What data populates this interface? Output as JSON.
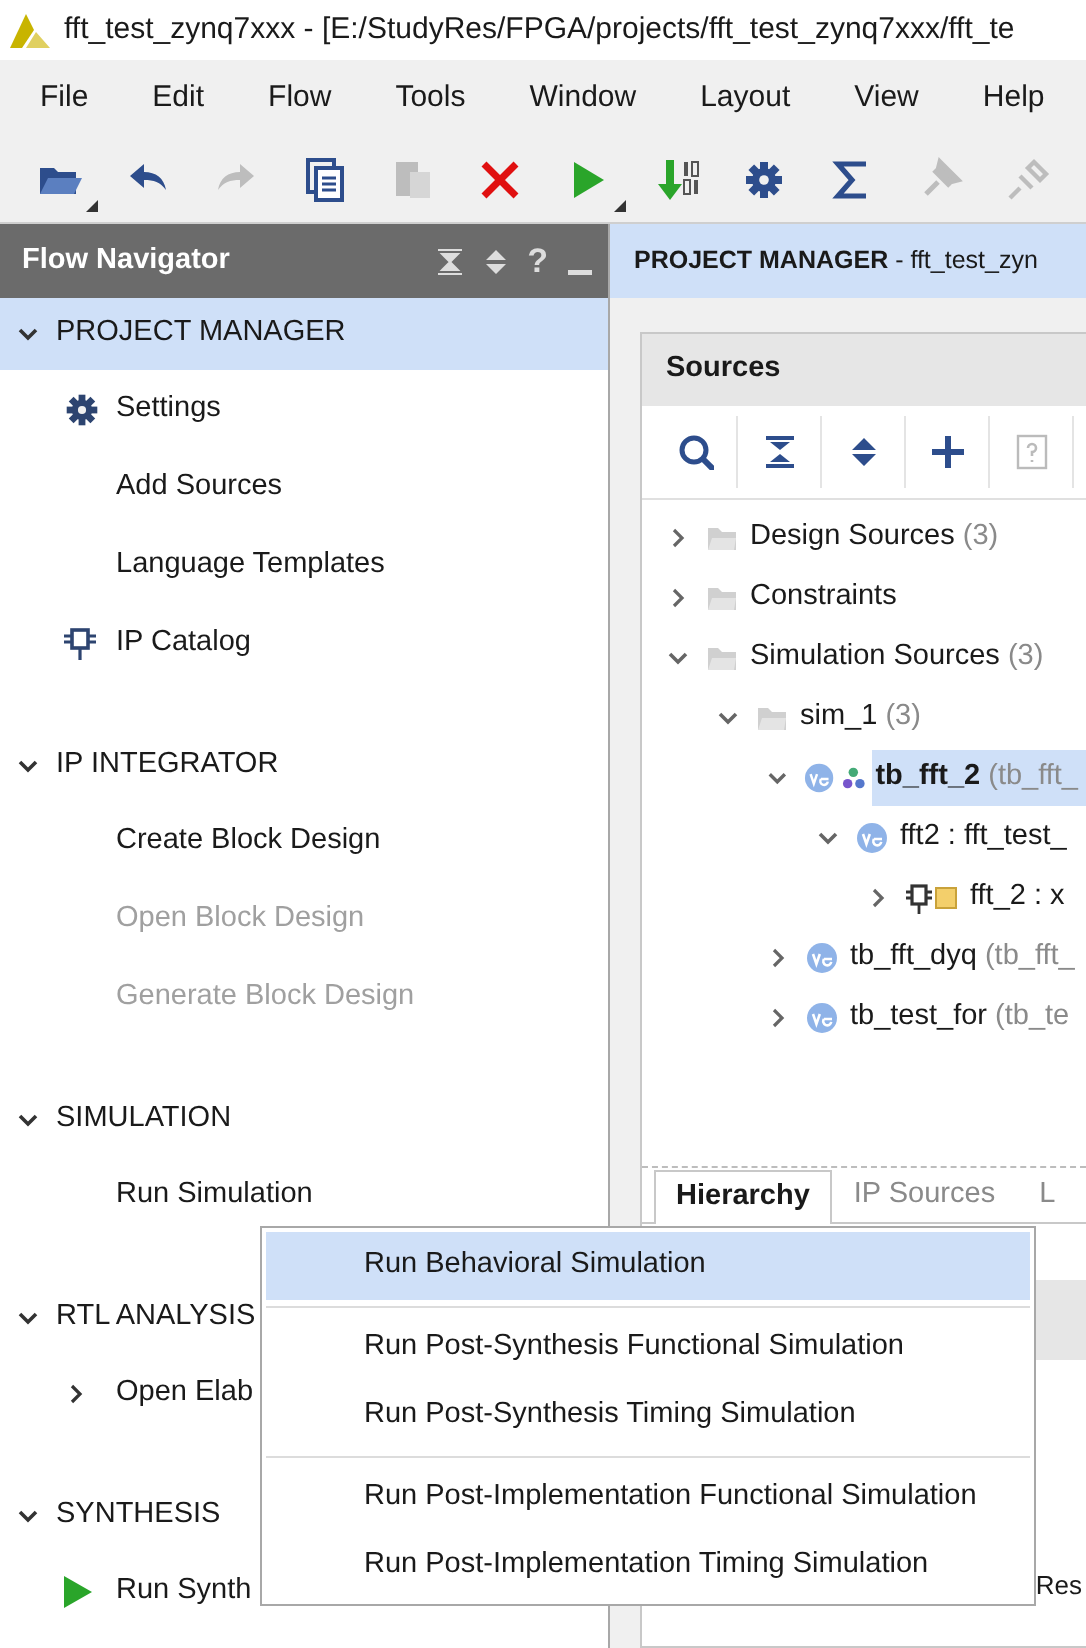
{
  "window": {
    "title": "fft_test_zynq7xxx - [E:/StudyRes/FPGA/projects/fft_test_zynq7xxx/fft_te"
  },
  "menu": [
    "File",
    "Edit",
    "Flow",
    "Tools",
    "Window",
    "Layout",
    "View",
    "Help"
  ],
  "toolbar": [
    {
      "kind": "open",
      "disabled": false,
      "dropdown": true
    },
    {
      "kind": "undo",
      "disabled": false,
      "dropdown": false
    },
    {
      "kind": "redo",
      "disabled": true,
      "dropdown": false
    },
    {
      "kind": "copy",
      "disabled": false,
      "dropdown": false
    },
    {
      "kind": "paste",
      "disabled": true,
      "dropdown": false
    },
    {
      "kind": "delete",
      "disabled": false,
      "dropdown": false
    },
    {
      "kind": "run",
      "disabled": false,
      "dropdown": true
    },
    {
      "kind": "bitstream",
      "disabled": false,
      "dropdown": false
    },
    {
      "kind": "settings",
      "disabled": false,
      "dropdown": false
    },
    {
      "kind": "sigma",
      "disabled": false,
      "dropdown": false
    },
    {
      "kind": "pin",
      "disabled": true,
      "dropdown": false
    },
    {
      "kind": "probe",
      "disabled": true,
      "dropdown": false
    }
  ],
  "flow_navigator": {
    "title": "Flow Navigator",
    "help": "?",
    "sections": [
      {
        "label": "PROJECT MANAGER",
        "expanded": true,
        "selected": true,
        "items": [
          {
            "label": "Settings",
            "kind": "settings",
            "disabled": false,
            "expandable": false
          },
          {
            "label": "Add Sources",
            "kind": "plain",
            "disabled": false,
            "expandable": false
          },
          {
            "label": "Language Templates",
            "kind": "plain",
            "disabled": false,
            "expandable": false
          },
          {
            "label": "IP Catalog",
            "kind": "catalog",
            "disabled": false,
            "expandable": false
          }
        ]
      },
      {
        "label": "IP INTEGRATOR",
        "expanded": true,
        "selected": false,
        "items": [
          {
            "label": "Create Block Design",
            "kind": "plain",
            "disabled": false,
            "expandable": false
          },
          {
            "label": "Open Block Design",
            "kind": "plain",
            "disabled": true,
            "expandable": false
          },
          {
            "label": "Generate Block Design",
            "kind": "plain",
            "disabled": true,
            "expandable": false
          }
        ]
      },
      {
        "label": "SIMULATION",
        "expanded": true,
        "selected": false,
        "items": [
          {
            "label": "Run Simulation",
            "kind": "plain",
            "disabled": false,
            "expandable": false
          }
        ]
      },
      {
        "label": "RTL ANALYSIS",
        "expanded": true,
        "selected": false,
        "items": [
          {
            "label": "Open Elab",
            "kind": "plain",
            "disabled": false,
            "expandable": true
          }
        ]
      },
      {
        "label": "SYNTHESIS",
        "expanded": true,
        "selected": false,
        "items": [
          {
            "label": "Run Synth",
            "kind": "run",
            "disabled": false,
            "expandable": false
          }
        ]
      }
    ]
  },
  "main_header": {
    "title": "**PROJECT MANAGER** - fft_test_zyn"
  },
  "sources": {
    "title": "Sources",
    "toolbar": [
      {
        "kind": "search",
        "disabled": false
      },
      {
        "kind": "collapse",
        "disabled": false
      },
      {
        "kind": "expand",
        "disabled": false
      },
      {
        "kind": "add",
        "disabled": false
      },
      {
        "kind": "help",
        "disabled": true
      }
    ],
    "tree": [
      {
        "kind": "folder",
        "label": "Design Sources",
        "detail": "(3)",
        "expanded": false,
        "selected": false,
        "top": false
      },
      {
        "kind": "folder",
        "label": "Constraints",
        "expanded": false,
        "selected": false,
        "top": false
      },
      {
        "kind": "folder",
        "label": "Simulation Sources",
        "detail": "(3)",
        "expanded": true,
        "selected": false,
        "top": false,
        "children": [
          {
            "kind": "folder",
            "label": "sim_1",
            "detail": "(3)",
            "expanded": true,
            "selected": false,
            "top": false,
            "children": [
              {
                "kind": "verilog",
                "label": "tb_fft_2",
                "detail": "(tb_fft_",
                "expanded": true,
                "selected": true,
                "top": true,
                "children": [
                  {
                    "kind": "verilog",
                    "label": "fft2 : fft_test_",
                    "expanded": true,
                    "selected": false,
                    "top": false,
                    "children": [
                      {
                        "kind": "ip",
                        "label": "fft_2 : x",
                        "expanded": false,
                        "selected": false,
                        "top": false
                      }
                    ]
                  }
                ]
              },
              {
                "kind": "verilog",
                "label": "tb_fft_dyq",
                "detail": "(tb_fft_",
                "expanded": false,
                "selected": false,
                "top": false
              },
              {
                "kind": "verilog",
                "label": "tb_test_for",
                "detail": "(tb_te",
                "expanded": false,
                "selected": false,
                "top": false
              }
            ]
          }
        ]
      }
    ],
    "tabs": [
      {
        "label": "Hierarchy",
        "selected": true
      },
      {
        "label": "IP Sources",
        "selected": false
      },
      {
        "label": "L",
        "selected": false
      }
    ],
    "column_3": "Res"
  },
  "context_menu": {
    "groups": [
      [
        {
          "label": "Run Behavioral Simulation",
          "selected": true
        }
      ],
      [
        {
          "label": "Run Post-Synthesis Functional Simulation",
          "selected": false
        },
        {
          "label": "Run Post-Synthesis Timing Simulation",
          "selected": false
        }
      ],
      [
        {
          "label": "Run Post-Implementation Functional Simulation",
          "selected": false
        },
        {
          "label": "Run Post-Implementation Timing Simulation",
          "selected": false
        }
      ]
    ]
  }
}
